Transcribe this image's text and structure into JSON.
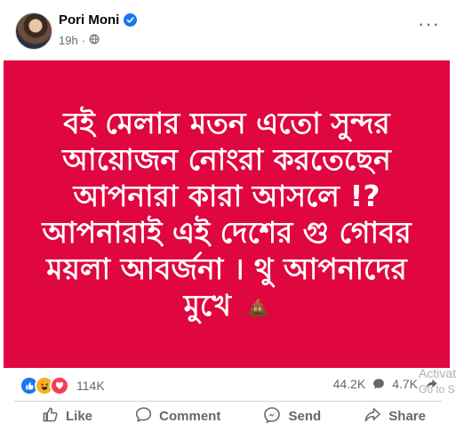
{
  "post": {
    "author": "Pori Moni",
    "time": "19h",
    "privacy_icon": "globe-icon",
    "text_lines": [
      "বই মেলার মতন এতো সুন্দর",
      "আয়োজন নোংরা করতেছেন",
      "আপনারা কারা আসলে !?",
      "আপনারাই এই দেশের গু গোবর",
      "ময়লা আবর্জনা । থু আপনাদের",
      "মুখে"
    ],
    "emoji": "pile-of-poo",
    "background_color": "#e0063f"
  },
  "stats": {
    "reactions_count": "114K",
    "reaction_icons": [
      "like-icon",
      "haha-icon",
      "love-icon"
    ],
    "comments_count": "44.2K",
    "shares_count": "4.7K"
  },
  "actions": {
    "like": "Like",
    "comment": "Comment",
    "send": "Send",
    "share": "Share"
  },
  "watermark": {
    "line1": "Activate",
    "line2": "Go to S"
  },
  "colors": {
    "accent": "#1877f2",
    "text_secondary": "#65676b",
    "post_background": "#e0063f"
  }
}
